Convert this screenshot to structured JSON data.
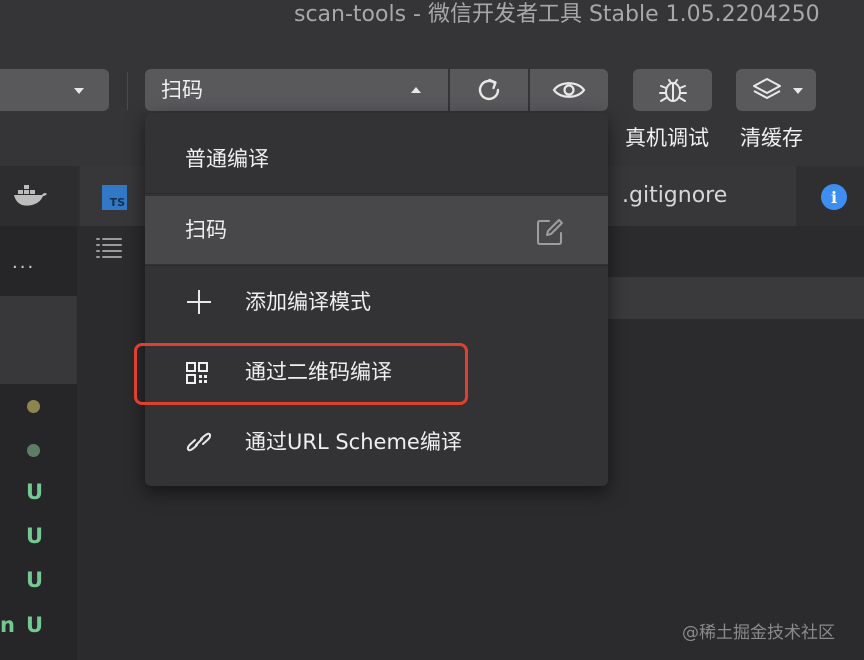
{
  "window": {
    "title": "scan-tools - 微信开发者工具 Stable 1.05.2204250"
  },
  "toolbar": {
    "mode_select": {
      "value": "扫码"
    },
    "debug_label": "真机调试",
    "cache_label": "清缓存"
  },
  "tabs": [
    {
      "label": ".gitignore"
    }
  ],
  "ts_badge": "TS",
  "dropdown": {
    "items": [
      {
        "label": "普通编译"
      },
      {
        "label": "扫码",
        "selected": true
      },
      {
        "label": "添加编译模式"
      },
      {
        "label": "通过二维码编译",
        "highlighted": true
      },
      {
        "label": "通过URL Scheme编译"
      }
    ]
  },
  "sidebar": {
    "more_label": "···",
    "file_statuses": [
      "U",
      "U",
      "U",
      "U"
    ],
    "trailing_char": "n"
  },
  "watermark": "@稀土掘金技术社区",
  "colors": {
    "accent_info": "#3d8ef0",
    "highlight_border": "#e0412f",
    "status_untracked": "#73c991"
  }
}
